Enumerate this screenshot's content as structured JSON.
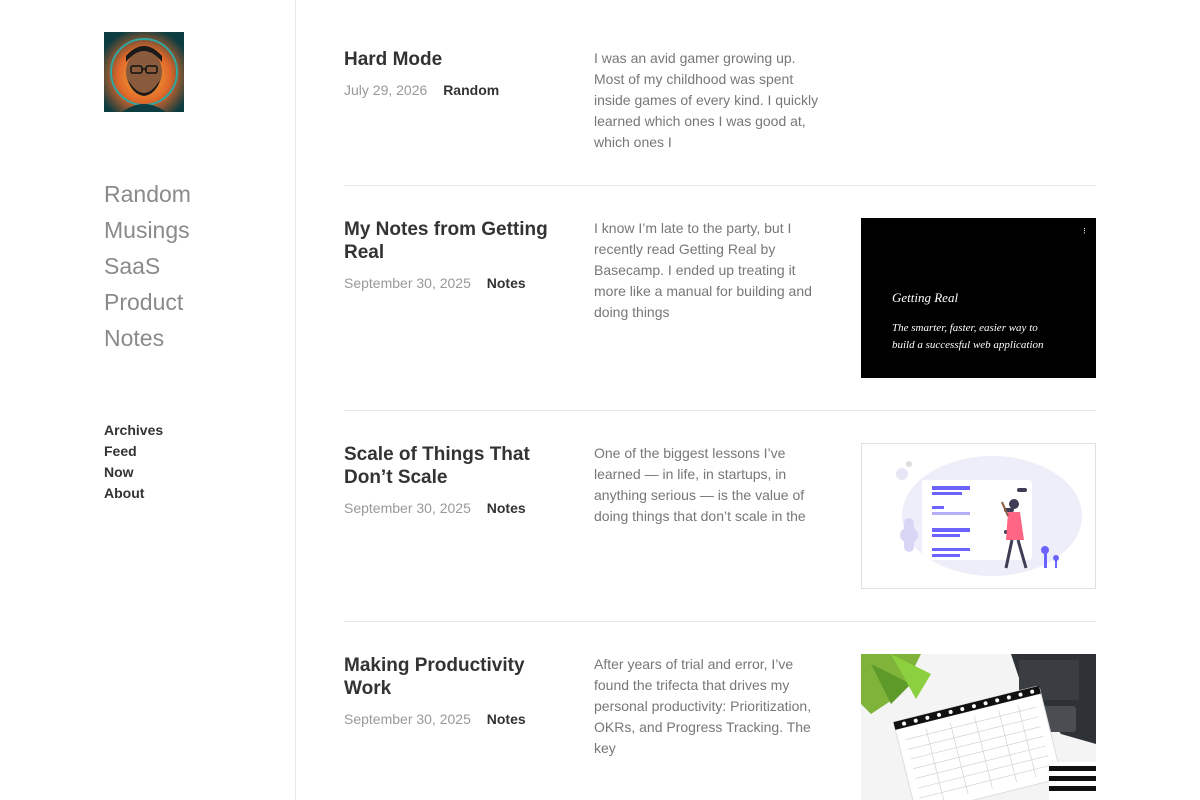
{
  "sidebar": {
    "categories": [
      "Random",
      "Musings",
      "SaaS",
      "Product",
      "Notes"
    ],
    "links": [
      "Archives",
      "Feed",
      "Now",
      "About"
    ]
  },
  "posts": [
    {
      "title": "Hard Mode",
      "date": "July 29, 2026",
      "category": "Random",
      "excerpt": "I was an avid gamer growing up. Most of my childhood was spent inside games of every kind. I quickly learned which ones I was good at, which ones I"
    },
    {
      "title": "My Notes from Getting Real",
      "date": "September 30, 2025",
      "category": "Notes",
      "excerpt": "I know I’m late to the party, but I recently read Getting Real by Basecamp. I ended up treating it more like a manual for building and doing things",
      "thumb_title": "Getting Real",
      "thumb_subtitle_1": "The smarter, faster, easier way to",
      "thumb_subtitle_2": "build a successful web application"
    },
    {
      "title": "Scale of Things That Don’t Scale",
      "date": "September 30, 2025",
      "category": "Notes",
      "excerpt": "One of the biggest lessons I’ve learned — in life, in startups, in anything serious — is the value of doing things that don’t scale in the"
    },
    {
      "title": "Making Productivity Work",
      "date": "September 30, 2025",
      "category": "Notes",
      "excerpt": "After years of trial and error, I’ve found the trifecta that drives my personal productivity: Prioritization, OKRs, and Progress Tracking. The key"
    }
  ],
  "colors": {
    "accent_purple": "#6c63ff",
    "text_dark": "#333333",
    "text_muted": "#999999"
  }
}
